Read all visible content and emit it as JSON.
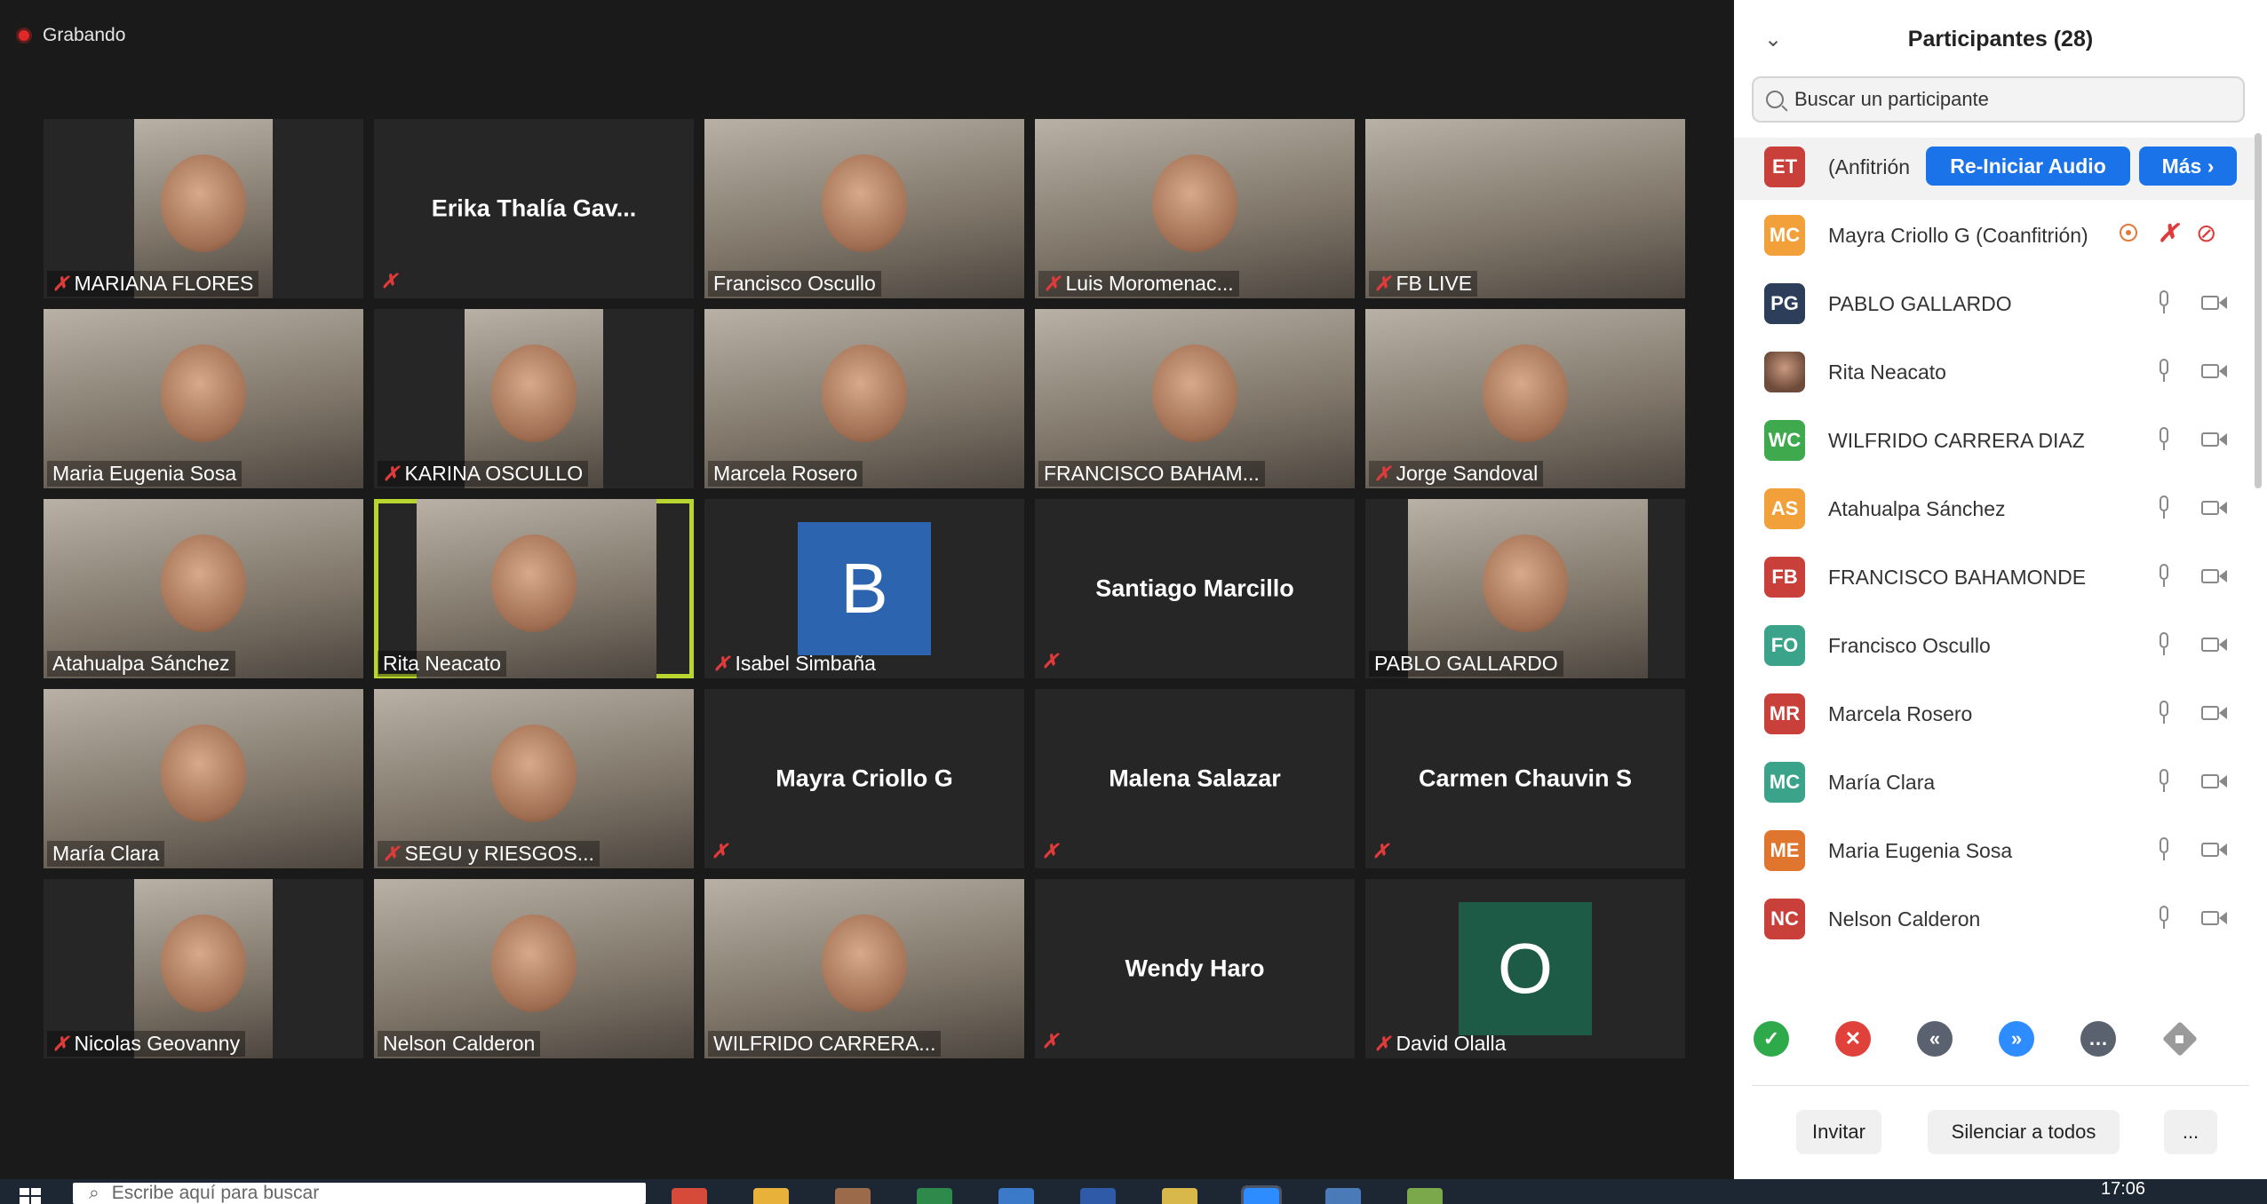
{
  "recording": {
    "label": "Grabando"
  },
  "tiles": [
    {
      "name": "MARIANA FLORES",
      "type": "video",
      "muted": true
    },
    {
      "name": "Erika Thalía Gav...",
      "type": "name",
      "muted": true
    },
    {
      "name": "Francisco Oscullo",
      "type": "video",
      "muted": false
    },
    {
      "name": "Luis Moromenac...",
      "type": "video",
      "muted": true
    },
    {
      "name": "FB LIVE",
      "type": "video",
      "muted": true
    },
    {
      "name": "Maria Eugenia Sosa",
      "type": "video",
      "muted": false
    },
    {
      "name": "KARINA OSCULLO",
      "type": "video",
      "muted": true
    },
    {
      "name": "Marcela Rosero",
      "type": "video",
      "muted": false
    },
    {
      "name": "FRANCISCO BAHAM...",
      "type": "video",
      "muted": false
    },
    {
      "name": "Jorge Sandoval",
      "type": "video",
      "muted": true
    },
    {
      "name": "Atahualpa Sánchez",
      "type": "video",
      "muted": false
    },
    {
      "name": "Rita Neacato",
      "type": "video",
      "muted": false
    },
    {
      "name": "Isabel  Simbaña",
      "type": "avatar",
      "letter": "B",
      "color": "#2d64b0",
      "muted": true
    },
    {
      "name": "Santiago Marcillo",
      "type": "name",
      "muted": true
    },
    {
      "name": "PABLO GALLARDO",
      "type": "video",
      "muted": false
    },
    {
      "name": "María Clara",
      "type": "video",
      "muted": false
    },
    {
      "name": "SEGU y RIESGOS...",
      "type": "video",
      "muted": true
    },
    {
      "name": "Mayra Criollo G",
      "type": "name",
      "muted": true
    },
    {
      "name": "Malena Salazar",
      "type": "name",
      "muted": true
    },
    {
      "name": "Carmen Chauvin S",
      "type": "name",
      "muted": true
    },
    {
      "name": "Nicolas Geovanny",
      "type": "video",
      "muted": true
    },
    {
      "name": "Nelson Calderon",
      "type": "video",
      "muted": false
    },
    {
      "name": "WILFRIDO CARRERA...",
      "type": "video",
      "muted": false
    },
    {
      "name": "Wendy Haro",
      "type": "name",
      "muted": true
    },
    {
      "name": "David Olalla",
      "type": "avatar",
      "letter": "O",
      "color": "#1e5b47",
      "muted": true
    }
  ],
  "panel": {
    "title": "Participantes (28)",
    "search_placeholder": "Buscar un participante",
    "host": {
      "initials": "ET",
      "color": "#c9403a",
      "label": "(Anfitrión",
      "reaudio": "Re-Iniciar Audio",
      "more": "Más ›"
    },
    "participants": [
      {
        "initials": "MC",
        "color": "#f2a13a",
        "name": "Mayra Criollo G (Coanfitrión)",
        "cohost": true
      },
      {
        "initials": "PG",
        "color": "#2c3e5a",
        "name": "PABLO GALLARDO"
      },
      {
        "initials": "",
        "color": "photo",
        "name": "Rita Neacato"
      },
      {
        "initials": "WC",
        "color": "#3fa94e",
        "name": "WILFRIDO CARRERA DIAZ"
      },
      {
        "initials": "AS",
        "color": "#f2a13a",
        "name": "Atahualpa Sánchez"
      },
      {
        "initials": "FB",
        "color": "#c9403a",
        "name": "FRANCISCO BAHAMONDE"
      },
      {
        "initials": "FO",
        "color": "#3aa38a",
        "name": "Francisco Oscullo"
      },
      {
        "initials": "MR",
        "color": "#c9403a",
        "name": "Marcela Rosero"
      },
      {
        "initials": "MC",
        "color": "#3aa38a",
        "name": "María Clara"
      },
      {
        "initials": "ME",
        "color": "#e0752e",
        "name": "Maria Eugenia Sosa"
      },
      {
        "initials": "NC",
        "color": "#c9403a",
        "name": "Nelson Calderon"
      }
    ],
    "reactions": [
      "✓",
      "✕",
      "«",
      "»",
      "…",
      "◆"
    ],
    "invite": "Invitar",
    "mute_all": "Silenciar a todos",
    "more_btn": "..."
  },
  "taskbar": {
    "search_placeholder": "Escribe aquí para buscar",
    "clock": "17:06"
  }
}
